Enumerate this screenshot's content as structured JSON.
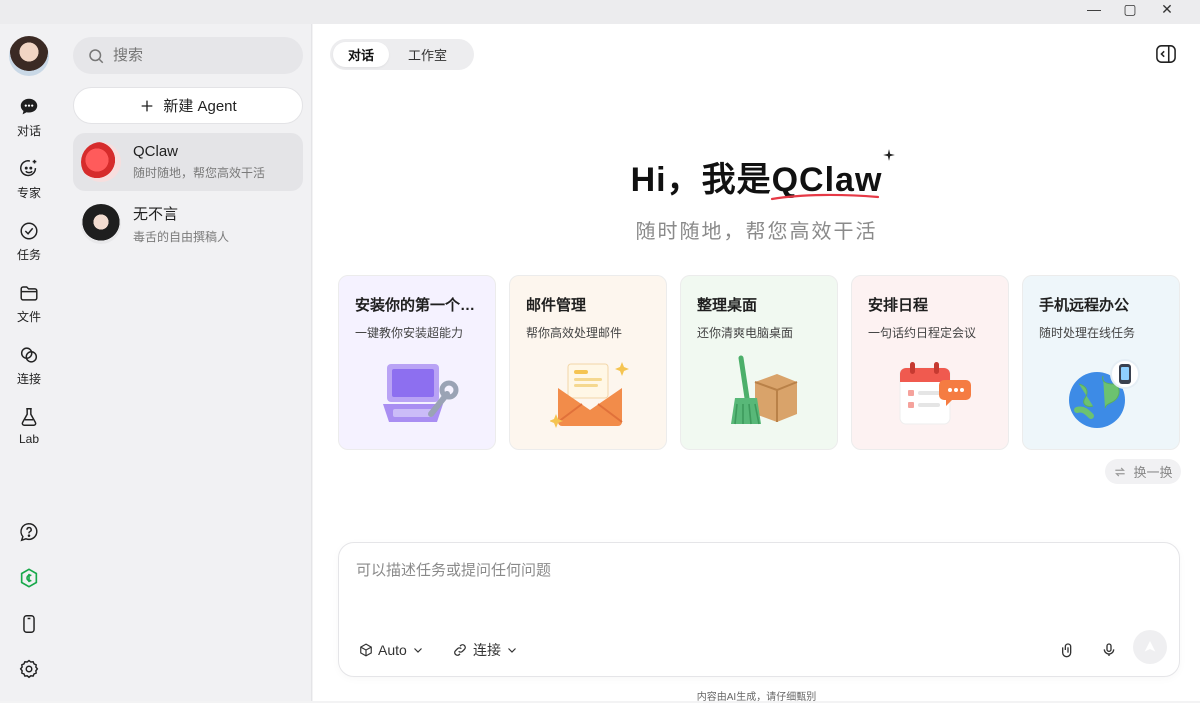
{
  "window": {
    "minimize": "—",
    "maximize": "▢",
    "close": "✕"
  },
  "rail": {
    "items": [
      {
        "label": "对话",
        "icon": "chat-bubble-icon"
      },
      {
        "label": "专家",
        "icon": "smile-sparkle-icon"
      },
      {
        "label": "任务",
        "icon": "check-circle-icon"
      },
      {
        "label": "文件",
        "icon": "folder-icon"
      },
      {
        "label": "连接",
        "icon": "link-icon"
      },
      {
        "label": "Lab",
        "icon": "flask-icon"
      }
    ],
    "bottom_icons": [
      "help-bubble-icon",
      "credits-icon",
      "phone-icon",
      "settings-gear-icon"
    ]
  },
  "sidebar": {
    "search_placeholder": "搜索",
    "new_agent_label": "新建 Agent",
    "agents": [
      {
        "name": "QClaw",
        "desc": "随时随地，帮您高效干活",
        "active": true
      },
      {
        "name": "无不言",
        "desc": "毒舌的自由撰稿人",
        "active": false
      }
    ]
  },
  "main": {
    "tabs": [
      {
        "label": "对话",
        "active": true
      },
      {
        "label": "工作室",
        "active": false
      }
    ],
    "hero_title": "Hi，我是QClaw",
    "hero_subtitle": "随时随地，帮您高效干活",
    "cards": [
      {
        "title": "安装你的第一个S...",
        "desc": "一键教你安装超能力",
        "bg": "#f5f2ff",
        "icon": "laptop-wrench-icon"
      },
      {
        "title": "邮件管理",
        "desc": "帮你高效处理邮件",
        "bg": "#fdf6ee",
        "icon": "envelope-icon"
      },
      {
        "title": "整理桌面",
        "desc": "还你清爽电脑桌面",
        "bg": "#f1f9f1",
        "icon": "broom-box-icon"
      },
      {
        "title": "安排日程",
        "desc": "一句话约日程定会议",
        "bg": "#fdf2f2",
        "icon": "calendar-icon"
      },
      {
        "title": "手机远程办公",
        "desc": "随时处理在线任务",
        "bg": "#eef6fa",
        "icon": "globe-phone-icon"
      }
    ],
    "shuffle_label": "换一换",
    "composer": {
      "placeholder": "可以描述任务或提问任何问题",
      "model_label": "Auto",
      "connect_label": "连接"
    },
    "disclaimer": "内容由AI生成，请仔细甄别"
  }
}
